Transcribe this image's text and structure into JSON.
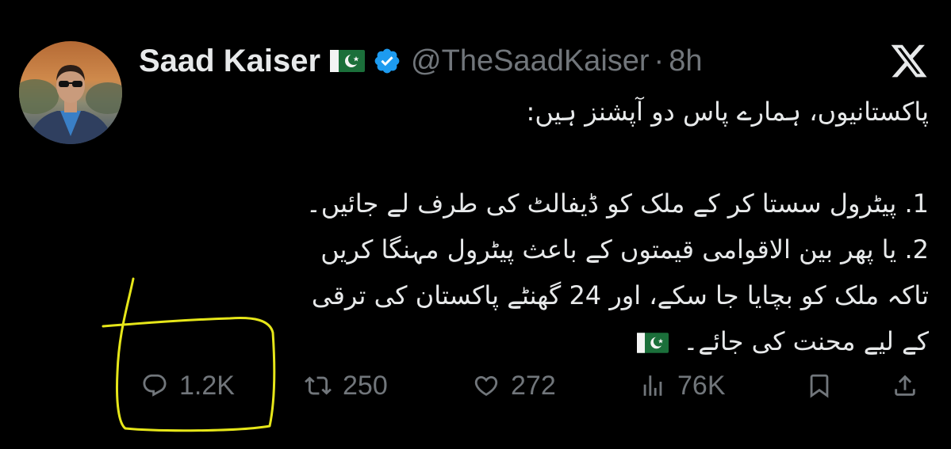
{
  "header": {
    "name": "Saad Kaiser",
    "handle": "@TheSaadKaiser",
    "separator": "·",
    "time": "8h"
  },
  "tweet": {
    "line1": "پاکستانیوں، ہمارے پاس دو آپشنز ہیں:",
    "line2": "1. پیٹرول سستا کر کے ملک کو ڈیفالٹ کی طرف لے جائیں۔",
    "line3": "2. یا پھر بین الاقوامی قیمتوں کے باعث پیٹرول مہنگا کریں",
    "line4": "تاکہ ملک کو بچایا جا سکے، اور 24 گھنٹے پاکستان کی ترقی",
    "line5": "کے لیے محنت کی جائے۔"
  },
  "actions": {
    "replies": "1.2K",
    "reposts": "250",
    "likes": "272",
    "views": "76K"
  },
  "icons": {
    "reply": "reply-icon",
    "repost": "repost-icon",
    "like": "heart-icon",
    "views": "views-icon",
    "bookmark": "bookmark-icon",
    "share": "share-icon",
    "verified": "verified-badge-icon",
    "logo": "x-logo-icon"
  },
  "colors": {
    "background": "#000000",
    "text": "#e7e9ea",
    "muted": "#71767b",
    "verified": "#1d9bf0",
    "annotation": "#f2f21a"
  }
}
